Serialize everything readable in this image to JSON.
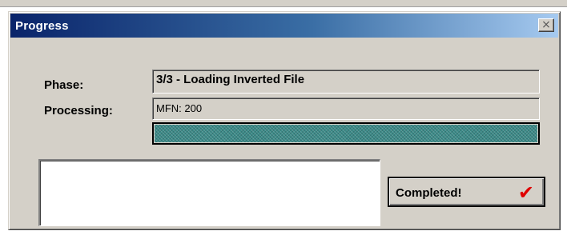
{
  "window": {
    "title": "Progress",
    "close_glyph": "×"
  },
  "phase": {
    "label": "Phase:",
    "value": "3/3 - Loading Inverted File"
  },
  "processing": {
    "label": "Processing:",
    "value": "MFN: 200"
  },
  "progress": {
    "fraction": 1.0,
    "fill_color": "#3c8a88"
  },
  "log": {
    "text": ""
  },
  "status_button": {
    "label": "Completed!",
    "icon": "red-checkmark-icon",
    "icon_glyph": "✔",
    "icon_color": "#e00000"
  }
}
